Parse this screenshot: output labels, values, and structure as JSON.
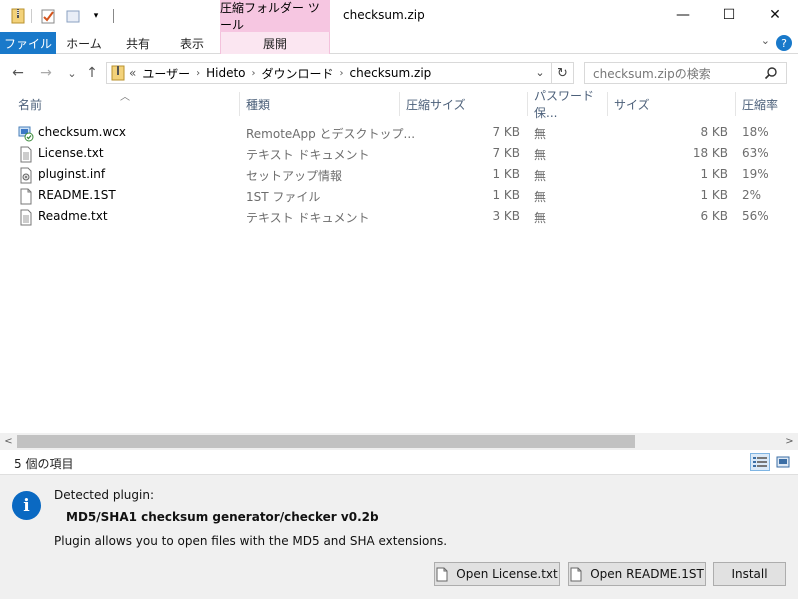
{
  "titlebar": {
    "context_tab_title": "圧縮フォルダー ツール",
    "window_title": "checksum.zip",
    "minimize": "—",
    "maximize": "☐",
    "close": "✕"
  },
  "ribbon": {
    "tabs": [
      {
        "label": "ファイル"
      },
      {
        "label": "ホーム"
      },
      {
        "label": "共有"
      },
      {
        "label": "表示"
      },
      {
        "label": "展開"
      }
    ],
    "help": "?"
  },
  "nav": {
    "back": "←",
    "forward": "→",
    "recent": "⌄",
    "up": "↑",
    "path_prefix": "«",
    "breadcrumb": [
      "ユーザー",
      "Hideto",
      "ダウンロード",
      "checksum.zip"
    ],
    "search_placeholder": "checksum.zipの検索"
  },
  "columns": [
    "名前",
    "種類",
    "圧縮サイズ",
    "パスワード保...",
    "サイズ",
    "圧縮率"
  ],
  "files": [
    {
      "name": "checksum.wcx",
      "type": "RemoteApp とデスクトップ...",
      "compressed": "7 KB",
      "password": "無",
      "size": "8 KB",
      "ratio": "18%",
      "icon": "wcx-file-icon"
    },
    {
      "name": "License.txt",
      "type": "テキスト ドキュメント",
      "compressed": "7 KB",
      "password": "無",
      "size": "18 KB",
      "ratio": "63%",
      "icon": "text-file-icon"
    },
    {
      "name": "pluginst.inf",
      "type": "セットアップ情報",
      "compressed": "1 KB",
      "password": "無",
      "size": "1 KB",
      "ratio": "19%",
      "icon": "inf-file-icon"
    },
    {
      "name": "README.1ST",
      "type": "1ST ファイル",
      "compressed": "1 KB",
      "password": "無",
      "size": "1 KB",
      "ratio": "2%",
      "icon": "generic-file-icon"
    },
    {
      "name": "Readme.txt",
      "type": "テキスト ドキュメント",
      "compressed": "3 KB",
      "password": "無",
      "size": "6 KB",
      "ratio": "56%",
      "icon": "text-file-icon"
    }
  ],
  "status": {
    "item_count": "5 個の項目"
  },
  "plugin_panel": {
    "detected_label": "Detected plugin:",
    "plugin_name": "MD5/SHA1 checksum generator/checker v0.2b",
    "description": "Plugin allows you to open files with the MD5 and SHA extensions.",
    "buttons": {
      "open_license": "Open License.txt",
      "open_readme": "Open README.1ST",
      "install": "Install"
    }
  },
  "colors": {
    "file_tab": "#1979ca",
    "context_tab": "#f6c6e1",
    "info_icon": "#0a69c2",
    "column_header_text": "#4c607a"
  }
}
